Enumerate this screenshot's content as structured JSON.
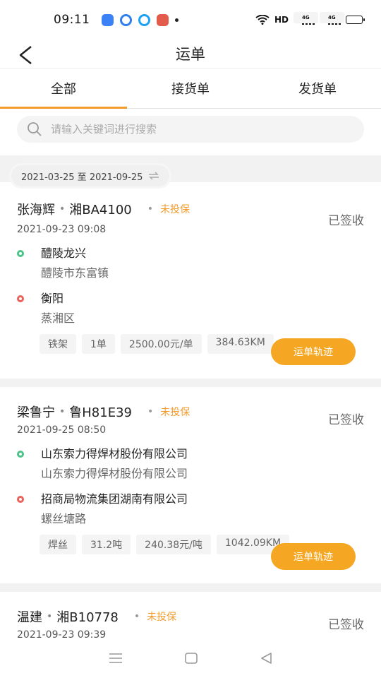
{
  "status_bar": {
    "time": "09:11",
    "network": "HD",
    "sig_tag_1": "4G",
    "sig_tag_2": "4G",
    "battery_level_pct": 90
  },
  "header": {
    "title": "运单"
  },
  "tabs": [
    {
      "label": "全部",
      "active": true
    },
    {
      "label": "接货单",
      "active": false
    },
    {
      "label": "发货单",
      "active": false
    }
  ],
  "search": {
    "placeholder": "请输入关键词进行搜索",
    "value": ""
  },
  "date_filter": {
    "label": "2021-03-25 至 2021-09-25"
  },
  "orders": [
    {
      "name": "张海辉",
      "plate": "湘BA4100",
      "insurance": "未投保",
      "status": "已签收",
      "time": "2021-09-23 09:08",
      "origin_title": "醴陵龙兴",
      "origin_sub": "醴陵市东富镇",
      "dest_title": "衡阳",
      "dest_sub": "蒸湘区",
      "tags": [
        "铁架",
        "1单",
        "2500.00元/单",
        "384.63KM"
      ],
      "button": "运单轨迹"
    },
    {
      "name": "梁鲁宁",
      "plate": "鲁H81E39",
      "insurance": "未投保",
      "status": "已签收",
      "time": "2021-09-25 08:50",
      "origin_title": "山东索力得焊材股份有限公司",
      "origin_sub": "山东索力得焊材股份有限公司",
      "dest_title": "招商局物流集团湖南有限公司",
      "dest_sub": "螺丝塘路",
      "tags": [
        "焊丝",
        "31.2吨",
        "240.38元/吨",
        "1042.09KM"
      ],
      "button": "运单轨迹"
    },
    {
      "name": "温建",
      "plate": "湘B10778",
      "insurance": "未投保",
      "status": "已签收",
      "time": "2021-09-23 09:39"
    }
  ],
  "colors": {
    "accent": "#f39c2b",
    "button": "#f5a623",
    "origin_pin": "#4cc38a",
    "dest_pin": "#e8625a"
  }
}
